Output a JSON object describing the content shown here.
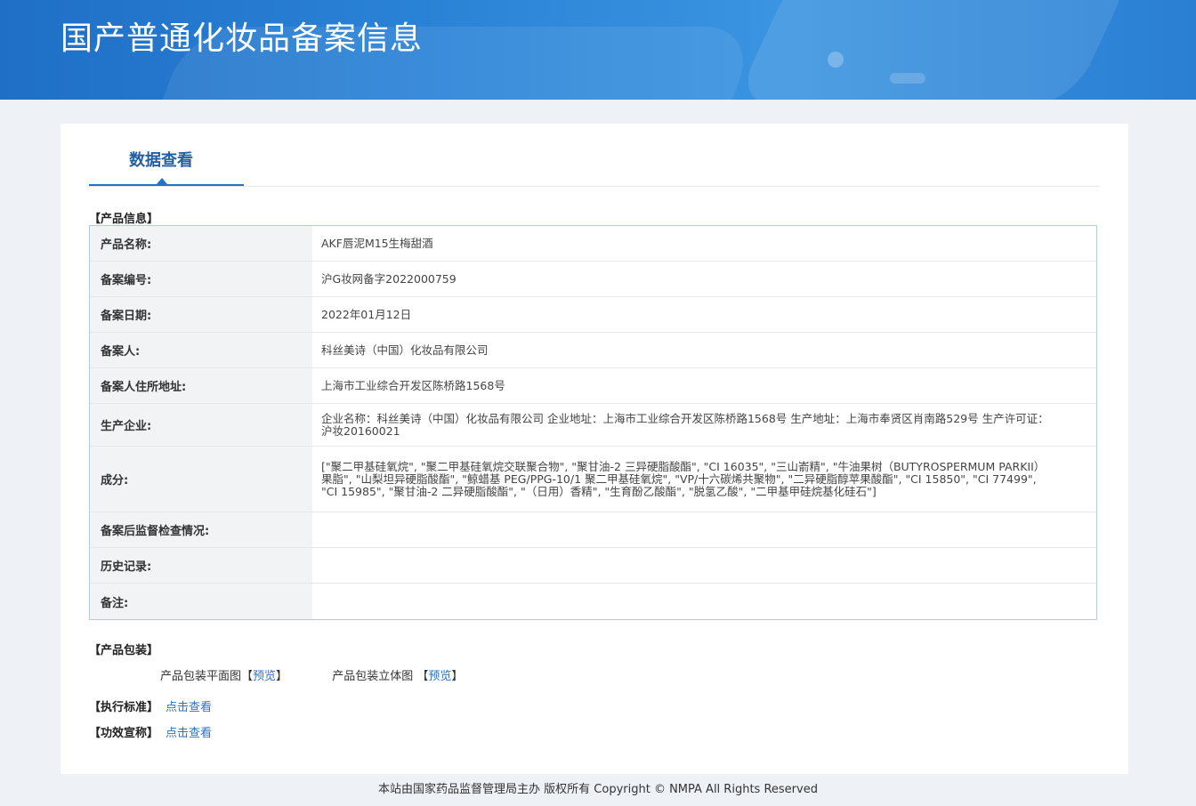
{
  "header": {
    "title": "国产普通化妆品备案信息"
  },
  "tabs": [
    {
      "label": "数据查看",
      "active": true
    }
  ],
  "sections": {
    "product_info": "【产品信息】",
    "packaging": "【产品包装】",
    "standard": "【执行标准】",
    "efficacy": "【功效宣称】"
  },
  "product": {
    "rows": [
      {
        "label": "产品名称:",
        "value": "AKF唇泥M15生梅甜酒"
      },
      {
        "label": "备案编号:",
        "value": "沪G妆网备字2022000759"
      },
      {
        "label": "备案日期:",
        "value": "2022年01月12日"
      },
      {
        "label": "备案人:",
        "value": "科丝美诗（中国）化妆品有限公司"
      },
      {
        "label": "备案人住所地址:",
        "value": "上海市工业综合开发区陈桥路1568号"
      },
      {
        "label": "生产企业:",
        "value": "企业名称：科丝美诗（中国）化妆品有限公司 企业地址：上海市工业综合开发区陈桥路1568号 生产地址：上海市奉贤区肖南路529号 生产许可证：沪妆20160021"
      },
      {
        "label": "成分:",
        "value": "[\"聚二甲基硅氧烷\", \"聚二甲基硅氧烷交联聚合物\", \"聚甘油-2 三异硬脂酸酯\", \"CI 16035\", \"三山嵛精\", \"牛油果树（BUTYROSPERMUM PARKII）果脂\", \"山梨坦异硬脂酸酯\", \"鲸蜡基 PEG/PPG-10/1 聚二甲基硅氧烷\", \"VP/十六碳烯共聚物\", \"二异硬脂醇苹果酸酯\", \"CI 15850\", \"CI 77499\", \"CI 15985\", \"聚甘油-2 二异硬脂酸酯\", \"（日用）香精\", \"生育酚乙酸酯\", \"脱氢乙酸\", \"二甲基甲硅烷基化硅石\"]"
      },
      {
        "label": "备案后监督检查情况:",
        "value": ""
      },
      {
        "label": "历史记录:",
        "value": ""
      },
      {
        "label": "备注:",
        "value": ""
      }
    ]
  },
  "packaging": {
    "flat_label": "产品包装平面图",
    "flat_open": "【",
    "flat_link": "预览",
    "flat_close": "】",
    "three_d_label": "产品包装立体图",
    "three_d_open": "【",
    "three_d_link": "预览",
    "three_d_close": "】"
  },
  "standard": {
    "link": "点击查看"
  },
  "efficacy": {
    "link": "点击查看"
  },
  "footer": {
    "text": "本站由国家药品监督管理局主办 版权所有 Copyright © NMPA All Rights Reserved"
  }
}
